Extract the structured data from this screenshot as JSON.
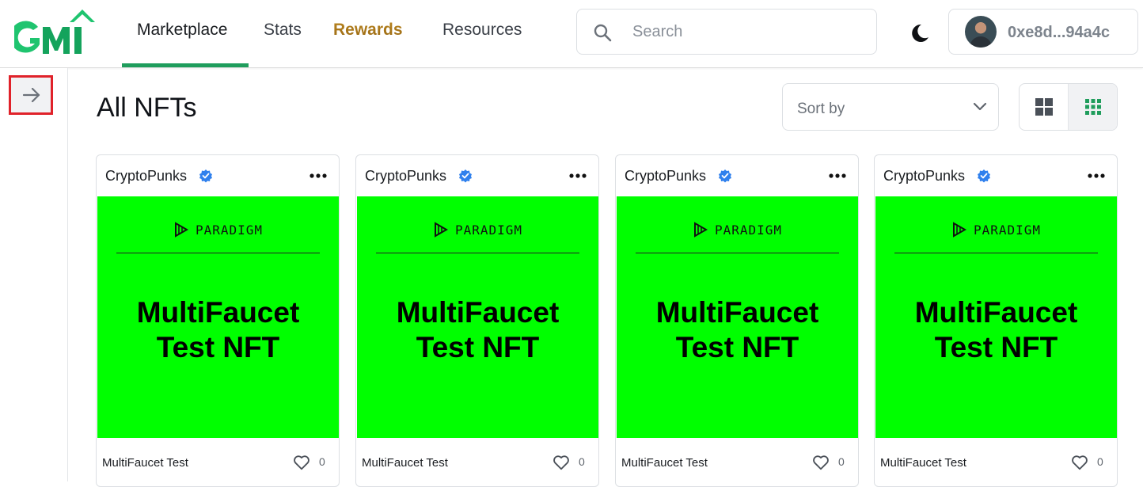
{
  "header": {
    "nav": {
      "marketplace": "Marketplace",
      "stats": "Stats",
      "rewards": "Rewards",
      "resources": "Resources"
    },
    "search": {
      "placeholder": "Search",
      "value": ""
    },
    "account": {
      "address": "0xe8d...94a4c"
    }
  },
  "main": {
    "title": "All NFTs",
    "sort": {
      "label": "Sort by"
    }
  },
  "cards": [
    {
      "collection": "CryptoPunks",
      "brand": "PARADIGM",
      "image_title_line1": "MultiFaucet",
      "image_title_line2": "Test NFT",
      "name": "MultiFaucet Test",
      "likes": "0"
    },
    {
      "collection": "CryptoPunks",
      "brand": "PARADIGM",
      "image_title_line1": "MultiFaucet",
      "image_title_line2": "Test NFT",
      "name": "MultiFaucet Test",
      "likes": "0"
    },
    {
      "collection": "CryptoPunks",
      "brand": "PARADIGM",
      "image_title_line1": "MultiFaucet",
      "image_title_line2": "Test NFT",
      "name": "MultiFaucet Test",
      "likes": "0"
    },
    {
      "collection": "CryptoPunks",
      "brand": "PARADIGM",
      "image_title_line1": "MultiFaucet",
      "image_title_line2": "Test NFT",
      "name": "MultiFaucet Test",
      "likes": "0"
    }
  ],
  "colors": {
    "brand_green": "#1f9d5c",
    "rewards_gold": "#a8741d",
    "nft_background": "#00ff00",
    "verified_blue": "#2f80ed",
    "highlight_red": "#e0222a"
  },
  "icons": [
    "gmi-logo",
    "search-icon",
    "moon-icon",
    "arrow-right-icon",
    "chevron-down-icon",
    "grid-large-icon",
    "grid-small-icon",
    "verified-icon",
    "more-icon",
    "paradigm-logo",
    "heart-icon"
  ]
}
